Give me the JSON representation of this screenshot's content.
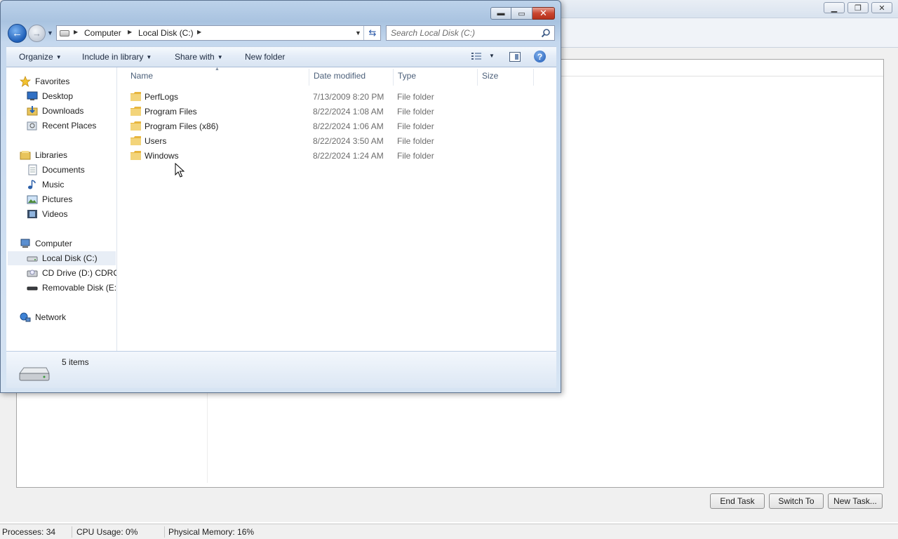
{
  "task_manager": {
    "buttons": {
      "end_task": "End Task",
      "switch_to": "Switch To",
      "new_task": "New Task..."
    },
    "status": {
      "processes": "Processes: 34",
      "cpu": "CPU Usage: 0%",
      "memory": "Physical Memory: 16%"
    }
  },
  "explorer": {
    "address": {
      "segments": [
        "Computer",
        "Local Disk (C:)"
      ]
    },
    "search": {
      "placeholder": "Search Local Disk (C:)"
    },
    "toolbar": {
      "organize": "Organize",
      "include_in_library": "Include in library",
      "share_with": "Share with",
      "new_folder": "New folder"
    },
    "nav": {
      "favorites": "Favorites",
      "desktop": "Desktop",
      "downloads": "Downloads",
      "recent_places": "Recent Places",
      "libraries": "Libraries",
      "documents": "Documents",
      "music": "Music",
      "pictures": "Pictures",
      "videos": "Videos",
      "computer": "Computer",
      "local_disk": "Local Disk (C:)",
      "cd_drive": "CD Drive (D:) CDROM",
      "removable_disk": "Removable Disk (E:)",
      "network": "Network"
    },
    "columns": {
      "name": "Name",
      "date_modified": "Date modified",
      "type": "Type",
      "size": "Size"
    },
    "files": [
      {
        "name": "PerfLogs",
        "date": "7/13/2009 8:20 PM",
        "type": "File folder"
      },
      {
        "name": "Program Files",
        "date": "8/22/2024 1:08 AM",
        "type": "File folder"
      },
      {
        "name": "Program Files (x86)",
        "date": "8/22/2024 1:06 AM",
        "type": "File folder"
      },
      {
        "name": "Users",
        "date": "8/22/2024 3:50 AM",
        "type": "File folder"
      },
      {
        "name": "Windows",
        "date": "8/22/2024 1:24 AM",
        "type": "File folder"
      }
    ],
    "details": {
      "item_count": "5 items"
    }
  }
}
